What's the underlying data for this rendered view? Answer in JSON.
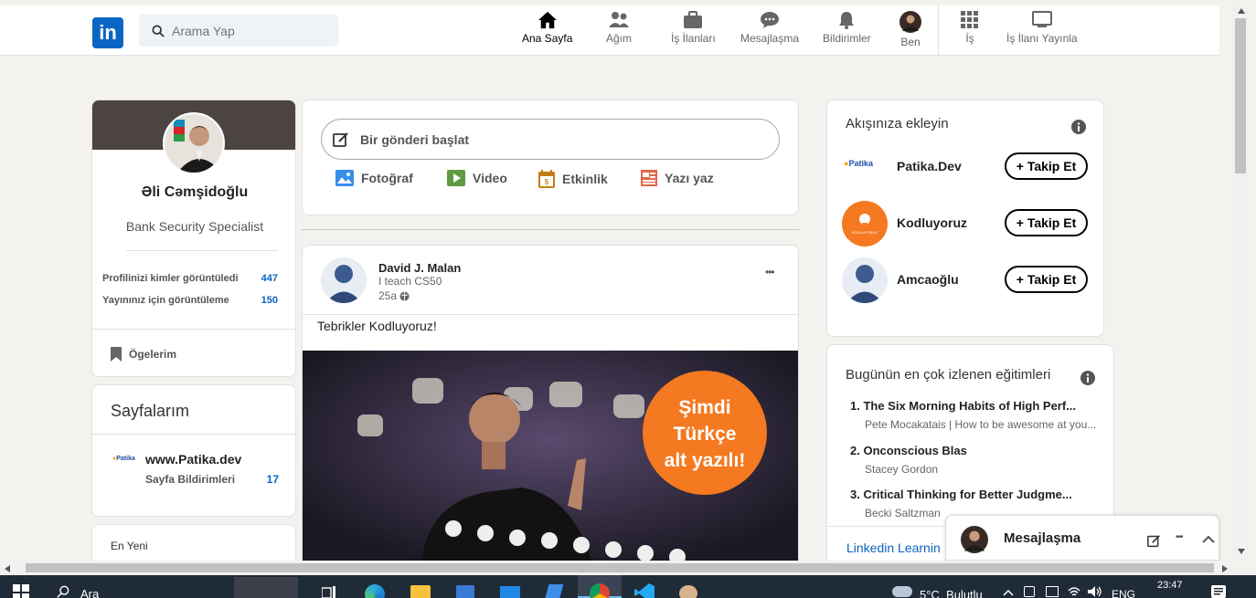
{
  "header": {
    "logo_text": "in",
    "search_placeholder": "Arama Yap",
    "nav": [
      "Ana Sayfa",
      "Ağım",
      "İş İlanları",
      "Mesajlaşma",
      "Bildirimler",
      "Ben",
      "İş",
      "İş İlanı Yayınla"
    ]
  },
  "profile": {
    "name": "Əli Cəmşidoğlu",
    "title": "Bank Security Specialist",
    "stats": [
      {
        "label": "Profilinizi kimler görüntüledi",
        "value": "447"
      },
      {
        "label": "Yayınınız için görüntüleme",
        "value": "150"
      }
    ],
    "saved_label": "Ögelerim"
  },
  "pages": {
    "title": "Sayfalarım",
    "item_logo": "Patika",
    "item_name": "www.Patika.dev",
    "notif_label": "Sayfa Bildirimleri",
    "notif_count": "17"
  },
  "recent": {
    "title": "En Yeni"
  },
  "composer": {
    "placeholder": "Bir gönderi başlat",
    "actions": [
      "Fotoğraf",
      "Video",
      "Etkinlik",
      "Yazı yaz"
    ]
  },
  "post": {
    "author": "David J. Malan",
    "subtitle": "I teach CS50",
    "time": "25a",
    "menu": "•••",
    "text": "Tebrikler Kodluyoruz!",
    "badge": [
      "Şimdi",
      "Türkçe",
      "alt yazılı!"
    ]
  },
  "follow": {
    "title": "Akışınıza ekleyin",
    "button_label": "+ Takip Et",
    "items": [
      {
        "name": "Patika.Dev",
        "logo": "Patika"
      },
      {
        "name": "Kodluyoruz",
        "logo": "KODLUYORUZ"
      },
      {
        "name": "Amcaoğlu"
      }
    ]
  },
  "courses": {
    "title": "Bugünün en çok izlenen eğitimleri",
    "items": [
      {
        "title": "1. The Six Morning Habits of High Perf...",
        "sub": "Pete Mocakatais | How to be awesome at you..."
      },
      {
        "title": "2. Onconscious Blas",
        "sub": "Stacey Gordon"
      },
      {
        "title": "3. Critical Thinking for Better Judgme...",
        "sub": "Becki Saltzman"
      }
    ],
    "link": "Linkedin Learnin"
  },
  "messaging": {
    "label": "Mesajlaşma",
    "dots": "•••"
  },
  "taskbar": {
    "search": "Ara",
    "weather": "5°C  Bulutlu",
    "lang": "ENG",
    "time": "23:47"
  },
  "colors": {
    "accent": "#0a66c2",
    "background": "#f3f2ef",
    "badge": "#f47920"
  }
}
